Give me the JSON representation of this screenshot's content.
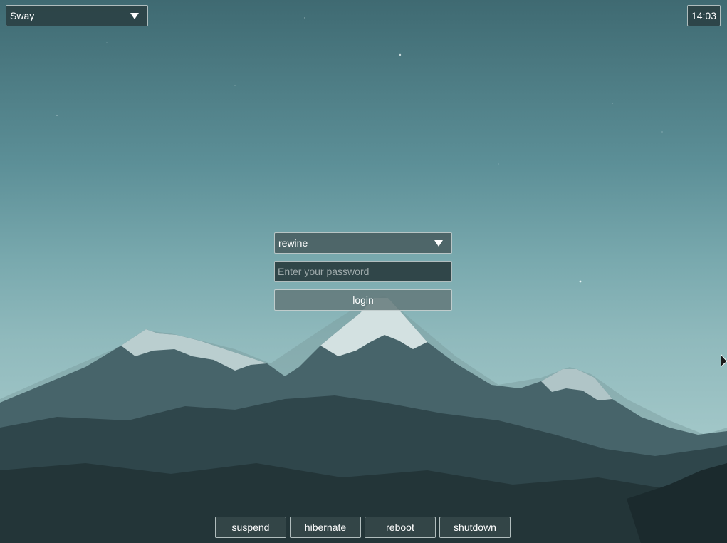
{
  "session": {
    "selected": "Sway",
    "icon": "chevron-down-icon"
  },
  "clock": {
    "time": "14:03"
  },
  "login": {
    "user_selected": "rewine",
    "password_placeholder": "Enter your password",
    "login_label": "login"
  },
  "power": {
    "suspend": "suspend",
    "hibernate": "hibernate",
    "reboot": "reboot",
    "shutdown": "shutdown"
  },
  "colors": {
    "sky_top": "#3f6a72",
    "sky_horizon": "#b6d6d5",
    "widget_bg": "#283a3c",
    "widget_border": "#dce6e6",
    "text": "#ffffff"
  }
}
